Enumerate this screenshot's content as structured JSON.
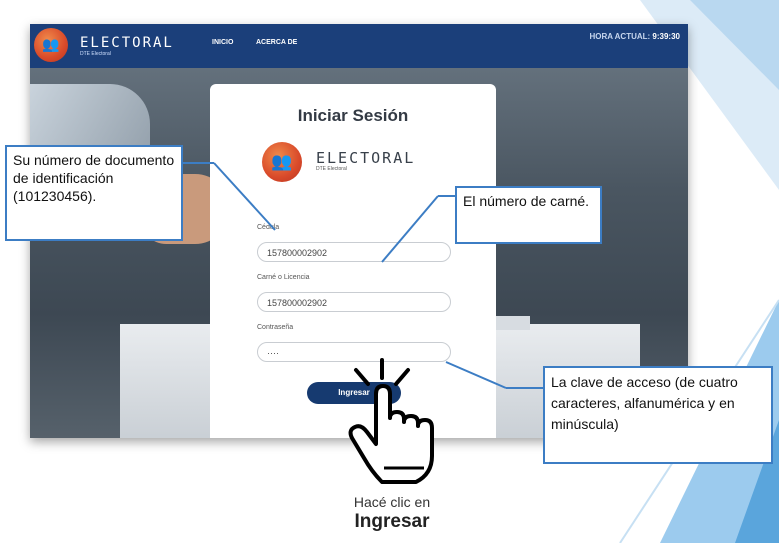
{
  "app": {
    "brand": "ELECTORAL",
    "brand_sub": "DTE Electoral",
    "nav": [
      "INICIO",
      "ACERCA DE"
    ],
    "clock_label": "HORA ACTUAL:",
    "clock_time": "9:39:30"
  },
  "login": {
    "title": "Iniciar Sesión",
    "brand": "ELECTORAL",
    "brand_sub": "DTE Electoral",
    "cedula_label": "Cédula",
    "cedula_value": "157800002902",
    "carne_label": "Carné o Licencia",
    "carne_value": "157800002902",
    "password_label": "Contraseña",
    "password_value": "····",
    "submit_label": "Ingresar"
  },
  "annotations": {
    "cedula_note": "Su número de documento de identificación (101230456).",
    "carne_note": "El número de carné.",
    "password_note": "La clave de acceso (de cuatro caracteres, alfanumérica y en minúscula)",
    "caption_line1": "Hacé clic en",
    "caption_line2": "Ingresar"
  },
  "colors": {
    "navbar": "#1b3f7a",
    "callout_border": "#3c7dc4",
    "button": "#163a70",
    "logo": "#e0622f"
  },
  "icons": [
    "people-logo-icon",
    "pointing-hand-icon"
  ]
}
